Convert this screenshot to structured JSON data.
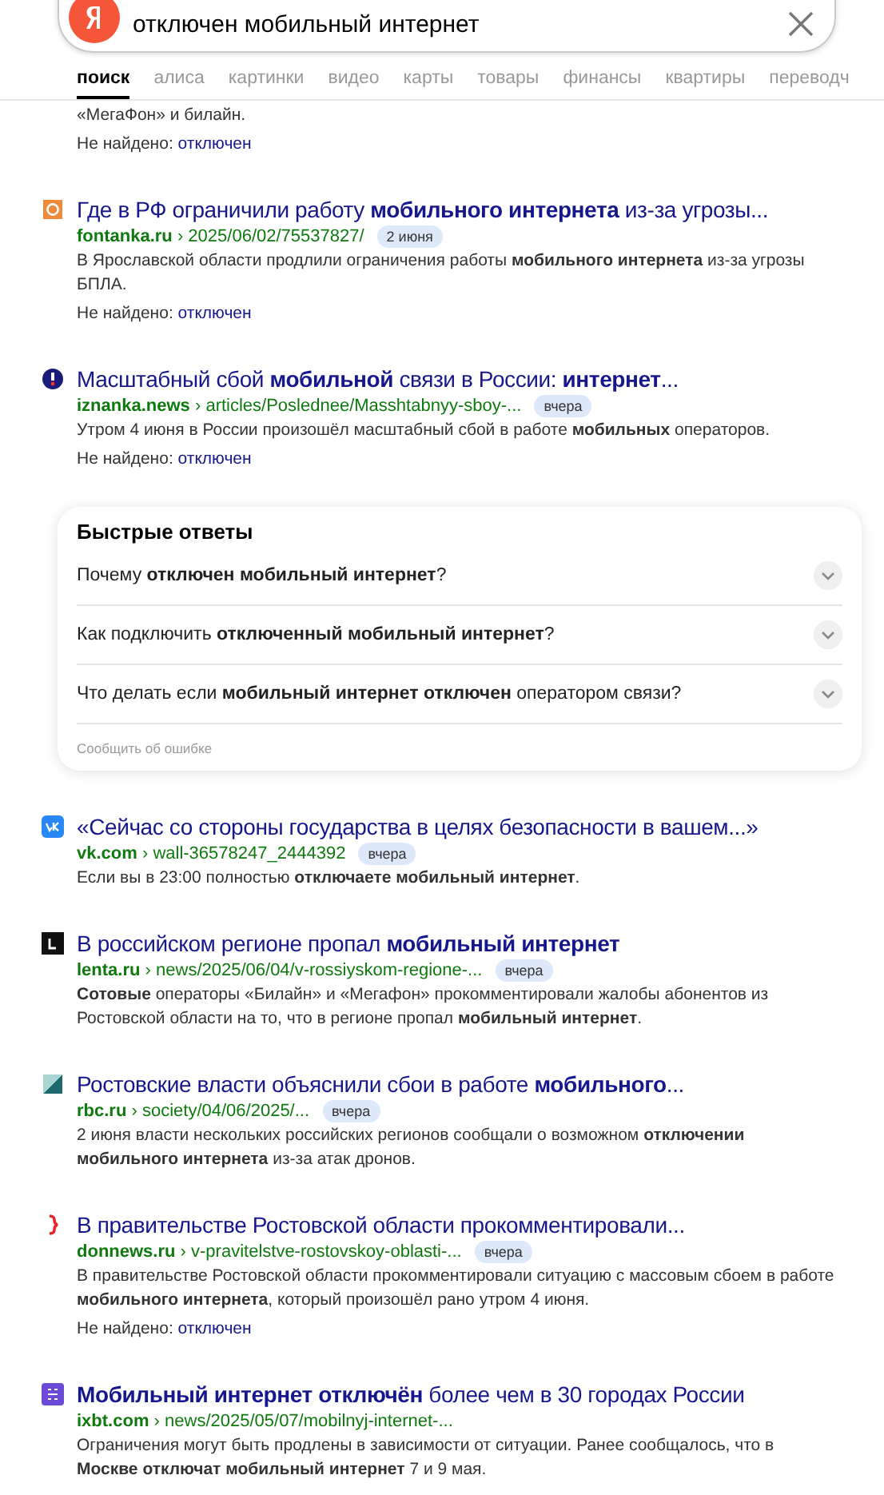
{
  "search": {
    "value": "отключен мобильный интернет"
  },
  "tabs": [
    {
      "label": "поиск",
      "selected": true
    },
    {
      "label": "алиса",
      "selected": false
    },
    {
      "label": "картинки",
      "selected": false
    },
    {
      "label": "видео",
      "selected": false
    },
    {
      "label": "карты",
      "selected": false
    },
    {
      "label": "товары",
      "selected": false
    },
    {
      "label": "финансы",
      "selected": false
    },
    {
      "label": "квартиры",
      "selected": false
    },
    {
      "label": "переводч",
      "selected": false
    }
  ],
  "results_top": [
    {
      "snippet": "«МегаФон» и билайн.",
      "not_found": {
        "label": "Не найдено:",
        "word": "отключен"
      }
    },
    {
      "kind": "fontanka",
      "title": "Где в РФ ограничили работу **мобильного интернета** из-за угрозы...",
      "domain": "fontanka.ru",
      "path": "› 2025/06/02/75537827/",
      "date": "2 июня",
      "snippet": "В Ярославской области продлили ограничения работы **мобильного интернета** из-за угрозы БПЛА.",
      "not_found": {
        "label": "Не найдено:",
        "word": "отключен"
      }
    },
    {
      "kind": "iznanka",
      "title": "Масштабный сбой **мобильной** связи в России: **интернет**...",
      "domain": "iznanka.news",
      "path": "› articles/Poslednee/Masshtabnyy-sboy-...",
      "date": "вчера",
      "snippet": "Утром 4 июня в России произошёл масштабный сбой в работе **мобильных** операторов.",
      "not_found": {
        "label": "Не найдено:",
        "word": "отключен"
      }
    }
  ],
  "quick_answers": {
    "title": "Быстрые ответы",
    "items": [
      {
        "text": "Почему **отключен мобильный интернет**?",
        "expanded": false
      },
      {
        "text": "Как подключить **отключенный мобильный интернет**?",
        "expanded": false
      },
      {
        "text": "Что делать если **мобильный интернет отключен** оператором связи?",
        "expanded": false
      }
    ],
    "report": "Сообщить об ошибке"
  },
  "results_bottom": [
    {
      "kind": "vk",
      "title": "«Сейчас со стороны государства в целях безопасности в вашем...»",
      "domain": "vk.com",
      "path": "› wall-36578247_2444392",
      "date": "вчера",
      "snippet": "Если вы в 23:00 полностью **отключаете мобильный интернет**."
    },
    {
      "kind": "lenta",
      "title": "В российском регионе пропал **мобильный интернет**",
      "domain": "lenta.ru",
      "path": "› news/2025/06/04/v-rossiyskom-regione-...",
      "date": "вчера",
      "snippet": "**Сотовые** операторы «Билайн» и «Мегафон» прокомментировали жалобы абонентов из Ростовской области на то, что в регионе пропал **мобильный интернет**."
    },
    {
      "kind": "rbc",
      "title": "Ростовские власти объяснили сбои в работе **мобильного**...",
      "domain": "rbc.ru",
      "path": "› society/04/06/2025/...",
      "date": "вчера",
      "snippet": "2 июня власти нескольких российских регионов сообщали о возможном **отключении мобильного интернета** из-за атак дронов."
    },
    {
      "kind": "donnews",
      "title": "В правительстве Ростовской области прокомментировали...",
      "domain": "donnews.ru",
      "path": "› v-pravitelstve-rostovskoy-oblasti-...",
      "date": "вчера",
      "snippet": "В правительстве Ростовской области прокомментировали ситуацию с массовым сбоем в работе **мобильного интернета**, который произошёл рано утром 4 июня.",
      "not_found": {
        "label": "Не найдено:",
        "word": "отключен"
      }
    },
    {
      "kind": "ixbt",
      "title": "**Мобильный интернет отключён** более чем в 30 городах России",
      "domain": "ixbt.com",
      "path": "› news/2025/05/07/mobilnyj-internet-...",
      "snippet": "Ограничения могут быть продлены в зависимости от ситуации. Ранее сообщалось, что в **Москве отключат мобильный интернет** 7 и 9 мая."
    }
  ]
}
